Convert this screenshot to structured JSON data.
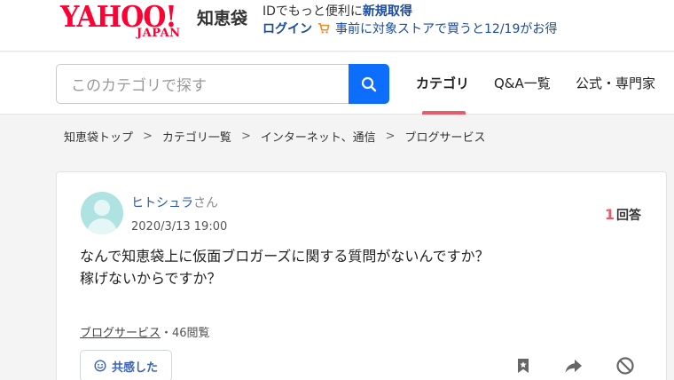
{
  "header": {
    "logo_text": "YAHOO!",
    "logo_sub": "JAPAN",
    "service_name": "知恵袋",
    "promo_prefix": "IDでもっと便利に",
    "promo_link": "新規取得",
    "login_label": "ログイン",
    "campaign_text": "事前に対象ストアで買うと12/19がお得"
  },
  "search": {
    "placeholder": "このカテゴリで探す"
  },
  "tabs": [
    {
      "label": "カテゴリ",
      "active": true
    },
    {
      "label": "Q&A一覧",
      "active": false
    },
    {
      "label": "公式・専門家",
      "active": false
    }
  ],
  "breadcrumb": [
    "知恵袋トップ",
    "カテゴリ一覧",
    "インターネット、通信",
    "ブログサービス"
  ],
  "question": {
    "user_name": "ヒトシュラ",
    "user_suffix": "さん",
    "posted_at": "2020/3/13 19:00",
    "answer_count": "1",
    "answer_label": "回答",
    "body_lines": [
      "なんで知恵袋上に仮面ブロガーズに関する質問がないんですか？",
      "稼げないからですか？"
    ],
    "category": "ブログサービス",
    "views": "・46閲覧",
    "empathy_label": "共感した"
  },
  "colors": {
    "brand_red": "#ff0033",
    "link_blue": "#1a4ba0",
    "search_blue": "#0d6efd",
    "accent_pink": "#e95a6a"
  },
  "icons": [
    "search-icon",
    "cart-icon",
    "smile-icon",
    "bookmark-icon",
    "share-icon",
    "block-icon"
  ]
}
